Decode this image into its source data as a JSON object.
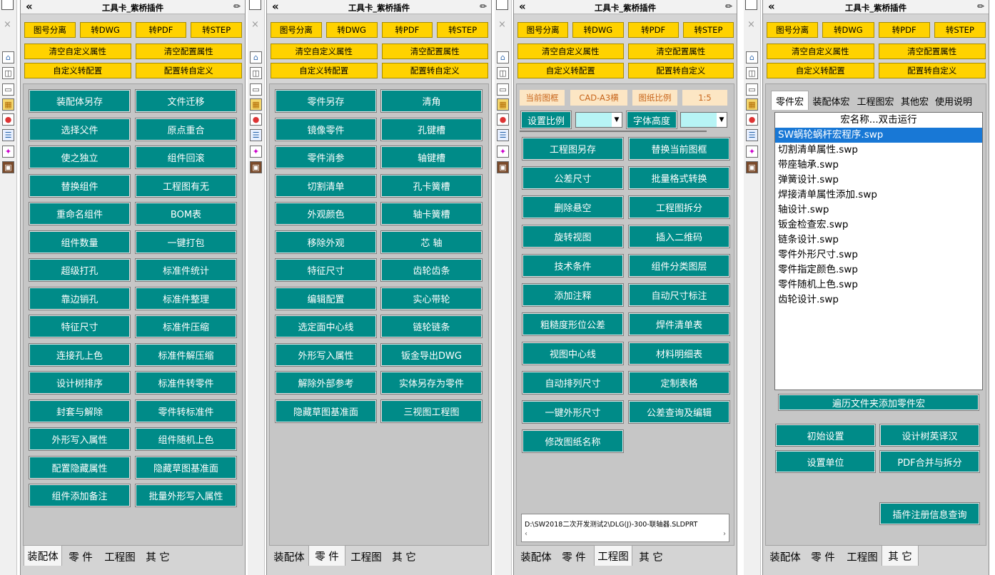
{
  "panel_title": "工具卡_紫桥插件",
  "top_buttons": [
    "图号分离",
    "转DWG",
    "转PDF",
    "转STEP"
  ],
  "clear_buttons": [
    "清空自定义属性",
    "清空配置属性"
  ],
  "convert_buttons": [
    "自定义转配置",
    "配置转自定义"
  ],
  "bottom_tabs": [
    "装配体",
    "零 件",
    "工程图",
    "其 它"
  ],
  "sidebar_icons": [
    "home-icon",
    "cylinder-icon",
    "folder-icon",
    "chart-icon",
    "color-wheel-icon",
    "list-icon",
    "palette-icon",
    "book-icon"
  ],
  "assembly_buttons": [
    "装配体另存",
    "文件迁移",
    "选择父件",
    "原点重合",
    "使之独立",
    "组件回滚",
    "替换组件",
    "工程图有无",
    "重命名组件",
    "BOM表",
    "组件数量",
    "一键打包",
    "超级打孔",
    "标准件统计",
    "靠边销孔",
    "标准件整理",
    "特征尺寸",
    "标准件压缩",
    "连接孔上色",
    "标准件解压缩",
    "设计树排序",
    "标准件转零件",
    "封套与解除",
    "零件转标准件",
    "外形写入属性",
    "组件随机上色",
    "配置隐藏属性",
    "隐藏草图基准面",
    "组件添加备注",
    "批量外形写入属性"
  ],
  "part_buttons": [
    "零件另存",
    "清角",
    "镜像零件",
    "孔键槽",
    "零件消参",
    "轴键槽",
    "切割清单",
    "孔卡簧槽",
    "外观颜色",
    "轴卡簧槽",
    "移除外观",
    "芯 轴",
    "特征尺寸",
    "齿轮齿条",
    "编辑配置",
    "实心带轮",
    "选定面中心线",
    "链轮链条",
    "外形写入属性",
    "钣金导出DWG",
    "解除外部参考",
    "实体另存为零件",
    "隐藏草图基准面",
    "三视图工程图"
  ],
  "drawing": {
    "info_labels": [
      "当前图框",
      "CAD-A3横",
      "图纸比例",
      "1:5"
    ],
    "set_scale_label": "设置比例",
    "font_height_label": "字体高度",
    "buttons": [
      "工程图另存",
      "替换当前图框",
      "公差尺寸",
      "批量格式转换",
      "删除悬空",
      "工程图拆分",
      "旋转视图",
      "插入二维码",
      "技术条件",
      "组件分类图层",
      "添加注释",
      "自动尺寸标注",
      "粗糙度形位公差",
      "焊件清单表",
      "视图中心线",
      "材料明细表",
      "自动排列尺寸",
      "定制表格",
      "一键外形尺寸",
      "公差查询及编辑",
      "修改图纸名称"
    ],
    "path": "D:\\SW2018二次开发测试2\\DLG(J)-300-联轴器.SLDPRT"
  },
  "other": {
    "tabs": [
      "零件宏",
      "装配体宏",
      "工程图宏",
      "其他宏",
      "使用说明"
    ],
    "list_header": "宏名称...双击运行",
    "macros": [
      "SW蜗轮蜗杆宏程序.swp",
      "切割清单属性.swp",
      "带座轴承.swp",
      "弹簧设计.swp",
      "焊接清单属性添加.swp",
      "轴设计.swp",
      "钣金检查宏.swp",
      "链条设计.swp",
      "零件外形尺寸.swp",
      "零件指定颜色.swp",
      "零件随机上色.swp",
      "齿轮设计.swp"
    ],
    "traverse_button": "遍历文件夹添加零件宏",
    "buttons": [
      "初始设置",
      "设计树英译汉",
      "设置单位",
      "PDF合并与拆分"
    ],
    "register_button": "插件注册信息查询"
  },
  "colors": {
    "accent_teal": "#008b88",
    "yellow": "#ffd200",
    "selection": "#1878d6"
  }
}
